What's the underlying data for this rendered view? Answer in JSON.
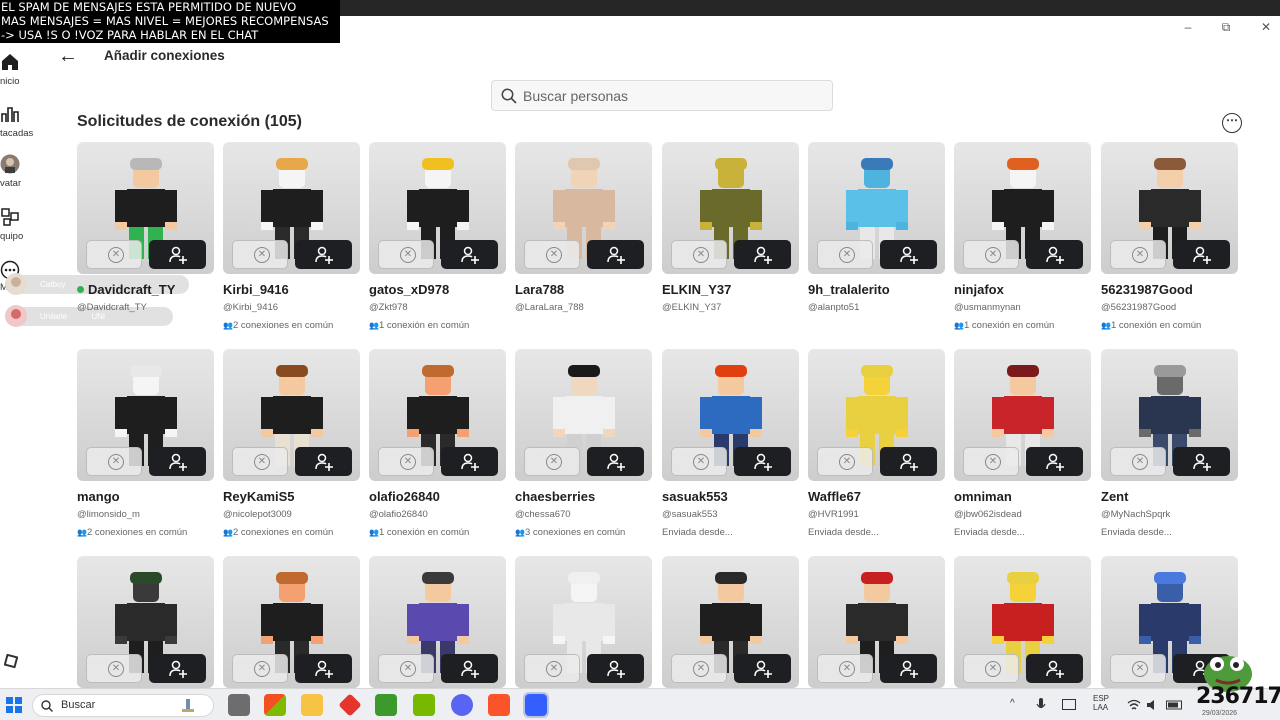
{
  "overlay": {
    "lines": [
      "EL SPAM DE MENSAJES ESTA PERMITIDO DE NUEVO",
      "MAS MENSAJES = MAS NIVEL = MEJORES RECOMPENSAS",
      "-> USA !S  O !VOZ PARA HABLAR EN EL CHAT"
    ]
  },
  "window": {
    "minimize": "–",
    "maximize": "⧉",
    "close": "✕"
  },
  "sidebar": {
    "items": [
      {
        "label": "nicio",
        "icon": "home-icon"
      },
      {
        "label": "tacadas",
        "icon": "chart-icon"
      },
      {
        "label": "vatar",
        "icon": "avatar-icon"
      },
      {
        "label": "quipo",
        "icon": "team-icon"
      },
      {
        "label": "Más",
        "icon": "more-icon"
      }
    ]
  },
  "chat_bubbles": [
    {
      "name": "Catboy",
      "text": ""
    },
    {
      "name": "Unilarie",
      "text": "UNI"
    }
  ],
  "header": {
    "back": "←",
    "title": "Añadir conexiones"
  },
  "search": {
    "placeholder": "Buscar personas"
  },
  "section": {
    "title": "Solicitudes de conexión (105)",
    "more": "⋯"
  },
  "requests": [
    {
      "username": "Davidcraft_TY",
      "handle": "@Davidcraft_TY",
      "mutual": "",
      "online": true
    },
    {
      "username": "Kirbi_9416",
      "handle": "@Kirbi_9416",
      "mutual": "2 conexiones en común",
      "online": false
    },
    {
      "username": "gatos_xD978",
      "handle": "@Zkt978",
      "mutual": "1 conexión en común",
      "online": false
    },
    {
      "username": "Lara788",
      "handle": "@LaraLara_788",
      "mutual": "",
      "online": false
    },
    {
      "username": "ELKIN_Y37",
      "handle": "@ELKIN_Y37",
      "mutual": "",
      "online": false
    },
    {
      "username": "9h_tralalerito",
      "handle": "@alanpto51",
      "mutual": "",
      "online": false
    },
    {
      "username": "ninjafox",
      "handle": "@usmanmynan",
      "mutual": "1 conexión en común",
      "online": false
    },
    {
      "username": "56231987Good",
      "handle": "@56231987Good",
      "mutual": "1 conexión en común",
      "online": false
    },
    {
      "username": "mango",
      "handle": "@limonsido_m",
      "mutual": "2 conexiones en común",
      "online": false
    },
    {
      "username": "ReyKamiS5",
      "handle": "@nicolepot3009",
      "mutual": "2 conexiones en común",
      "online": false
    },
    {
      "username": "olafio26840",
      "handle": "@olafio26840",
      "mutual": "1 conexión en común",
      "online": false
    },
    {
      "username": "chaesberries",
      "handle": "@chessa670",
      "mutual": "3 conexiones en común",
      "online": false
    },
    {
      "username": "sasuak553",
      "handle": "@sasuak553",
      "mutual": "Enviada desde...",
      "online": false
    },
    {
      "username": "Waffle67",
      "handle": "@HVR1991",
      "mutual": "Enviada desde...",
      "online": false
    },
    {
      "username": "omniman",
      "handle": "@jbw062isdead",
      "mutual": "Enviada desde...",
      "online": false
    },
    {
      "username": "Zent",
      "handle": "@MyNachSpqrk",
      "mutual": "Enviada desde...",
      "online": false
    },
    {
      "username": "",
      "handle": "",
      "mutual": "",
      "online": false
    },
    {
      "username": "",
      "handle": "",
      "mutual": "",
      "online": false
    },
    {
      "username": "",
      "handle": "",
      "mutual": "",
      "online": false
    },
    {
      "username": "",
      "handle": "",
      "mutual": "",
      "online": false
    },
    {
      "username": "",
      "handle": "",
      "mutual": "",
      "online": false
    },
    {
      "username": "",
      "handle": "",
      "mutual": "",
      "online": false
    },
    {
      "username": "",
      "handle": "",
      "mutual": "",
      "online": false
    },
    {
      "username": "",
      "handle": "",
      "mutual": "",
      "online": false
    }
  ],
  "taskbar": {
    "search_label": "Buscar",
    "lang": "ESP",
    "lang2": "LAA",
    "clock_big": "236717",
    "date": "29/03/2026"
  },
  "colors": {
    "accept_bg": "#1e1f22",
    "online": "#2fb34f"
  }
}
